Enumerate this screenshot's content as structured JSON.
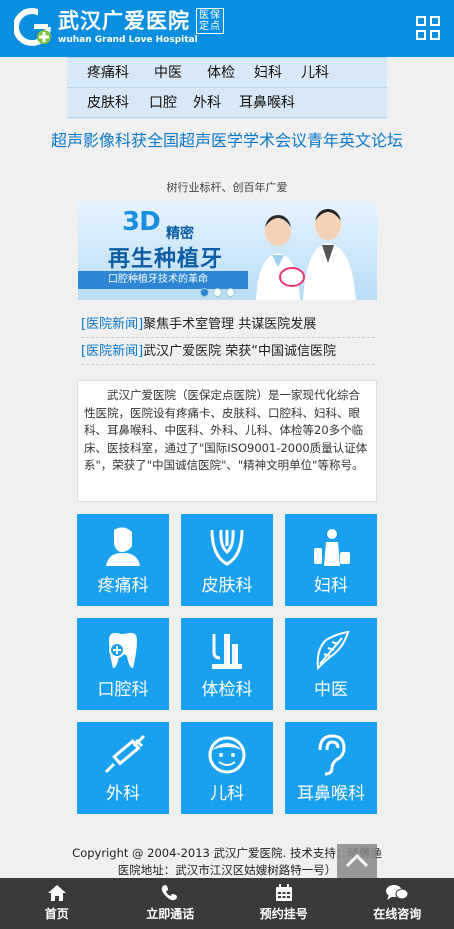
{
  "header": {
    "logo_cn": "武汉广爱医院",
    "logo_badge_line1": "医保",
    "logo_badge_line2": "定点",
    "logo_en": "wuhan Grand Love Hospital"
  },
  "nav": {
    "row1": [
      "疼痛科",
      "中医",
      "体检",
      "妇科",
      "儿科"
    ],
    "row2": [
      "皮肤科",
      "口腔",
      "外科",
      "耳鼻喉科"
    ]
  },
  "article": {
    "title": "超声影像科获全国超声医学学术会议青年英文论坛",
    "subtitle": "树行业标杆、创百年广爱"
  },
  "banner": {
    "badge": "3D",
    "badge_suffix": "精密",
    "headline": "再生种植牙",
    "strip": "口腔种植牙技术的革命",
    "slides": 3,
    "active_slide": 0
  },
  "news": [
    {
      "tag": "[医院新闻]",
      "text": "聚焦手术室管理 共谋医院发展"
    },
    {
      "tag": "[医院新闻]",
      "text": "武汉广爱医院 荣获“中国诚信医院"
    }
  ],
  "intro": "武汉广爱医院（医保定点医院）是一家现代化综合性医院，医院设有疼痛卡、皮肤科、口腔科、妇科、眼科、耳鼻喉科、中医科、外科、儿科、体检等20多个临床、医技科室，通过了\"国际ISO9001-2000质量认证体系\"，荣获了\"中国诚信医院\"、\"精神文明单位\"等称号。",
  "departments": [
    {
      "label": "疼痛科",
      "icon": "person-icon"
    },
    {
      "label": "皮肤科",
      "icon": "skin-icon"
    },
    {
      "label": "妇科",
      "icon": "women-icon"
    },
    {
      "label": "口腔科",
      "icon": "tooth-icon"
    },
    {
      "label": "体检科",
      "icon": "checkup-icon"
    },
    {
      "label": "中医",
      "icon": "herb-icon"
    },
    {
      "label": "外科",
      "icon": "syringe-icon"
    },
    {
      "label": "儿科",
      "icon": "child-face-icon"
    },
    {
      "label": "耳鼻喉科",
      "icon": "ear-icon"
    }
  ],
  "footer_info": {
    "copyright": "Copyright @ 2004-2013 武汉广爱医院. 技术支持：晓傅渔",
    "address": "医院地址：武汉市江汉区姑嫂树路特一号）"
  },
  "footer_nav": [
    {
      "label": "首页",
      "icon": "home-icon"
    },
    {
      "label": "立即通话",
      "icon": "phone-icon"
    },
    {
      "label": "预约挂号",
      "icon": "calendar-icon"
    },
    {
      "label": "在线咨询",
      "icon": "chat-icon"
    }
  ],
  "colors": {
    "brand": "#0a8ee0",
    "tile": "#19a0ef",
    "nav_bg": "#d7e9f7",
    "footer": "#3a3a3a"
  }
}
